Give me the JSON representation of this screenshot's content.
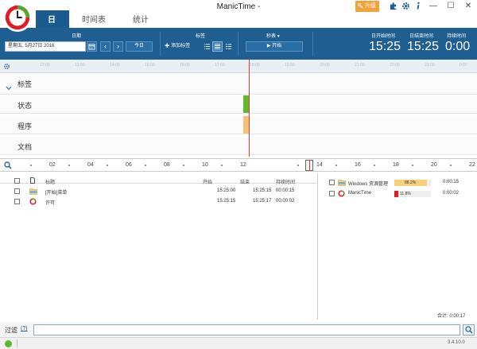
{
  "window": {
    "title": "ManicTime -",
    "upgrade_label": "升级",
    "minimize": "—",
    "maximize": "☐",
    "close": "✕"
  },
  "nav": {
    "tabs": [
      {
        "label": "日",
        "active": true
      },
      {
        "label": "时间表",
        "active": false
      },
      {
        "label": "统计",
        "active": false
      }
    ]
  },
  "ribbon": {
    "date_header": "日期",
    "date_value": "星期五, 5月27日 2016",
    "today_label": "今日",
    "tags_header": "标签",
    "add_tag_label": "添加标签",
    "stopwatch_header": "秒表",
    "start_label": "开始",
    "day_start_header": "日开始时间",
    "day_start_value": "15:25",
    "day_end_header": "日结束时间",
    "day_end_value": "15:25",
    "duration_header": "持续时间",
    "duration_value": "0:00"
  },
  "ruler": {
    "ticks": [
      "12:00",
      "13:00",
      "14:00",
      "15:00",
      "16:00",
      "17:00",
      "18:00",
      "19:00",
      "20:00",
      "21:00",
      "22:00",
      "23:00",
      "0:00"
    ]
  },
  "rows": [
    {
      "label": "标签"
    },
    {
      "label": "状态"
    },
    {
      "label": "程序"
    },
    {
      "label": "文档"
    }
  ],
  "timebar": {
    "labels": [
      "02",
      "04",
      "06",
      "08",
      "10",
      "12",
      "14",
      "16",
      "18",
      "20",
      "22"
    ]
  },
  "table": {
    "headers": {
      "title": "标题",
      "start": "开始",
      "end": "结束",
      "duration": "持续时间"
    },
    "rows": [
      {
        "title": "[开始]菜单",
        "start": "15:25:00",
        "end": "15:25:15",
        "duration": "00:00:15"
      },
      {
        "title": "许可",
        "start": "15:25:15",
        "end": "15:25:17",
        "duration": "00:00:02"
      }
    ]
  },
  "apps": {
    "rows": [
      {
        "name": "Windows 资源管理",
        "percent": "88.2%",
        "fraction": 0.882,
        "color": "#f5d27a",
        "duration": "0:00:15"
      },
      {
        "name": "ManicTime",
        "percent": "11.8%",
        "fraction": 0.118,
        "color": "#e31b23",
        "duration": "0:00:02"
      }
    ],
    "total": "合计: 0:00:17"
  },
  "filter": {
    "label": "过滤",
    "help": "(?)"
  },
  "status": {
    "version": "3.4.10.0"
  },
  "colors": {
    "ribbon_bg": "#1f5e91",
    "state_active": "#5dba2f",
    "app_bar": "#f2c27a",
    "now_line": "#e53935"
  }
}
